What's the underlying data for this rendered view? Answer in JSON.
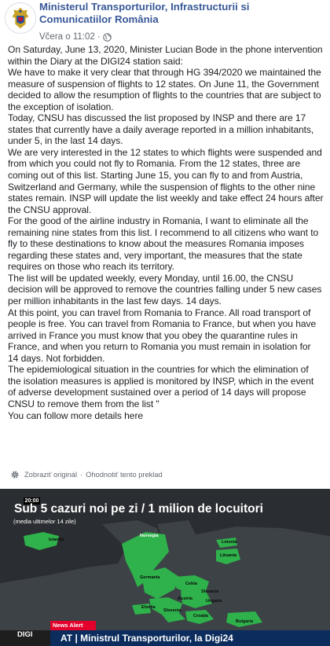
{
  "header": {
    "page_name": "Ministerul Transporturilor, Infrastructurii si Comunicatiilor România",
    "timestamp": "Včera o 11:02",
    "separator": "·",
    "privacy_icon": "globe-icon",
    "avatar_icon": "romanian-coat-of-arms"
  },
  "post": {
    "paragraphs": [
      "On Saturday, June 13, 2020, Minister Lucian Bode in the phone intervention within the Diary at the DIGI24 station said:",
      "We have to make it very clear that through HG 394/2020 we maintained the measure of suspension of flights to 12 states. On June 11, the Government decided to allow the resumption of flights to the countries that are subject to the exception of isolation.",
      "Today, CNSU has discussed the list proposed by INSP and there are 17 states that currently have a daily average reported in a million inhabitants, under 5, in the last 14 days.",
      "We are very interested in the 12 states to which flights were suspended and from which you could not fly to Romania. From the 12 states, three are coming out of this list. Starting June 15, you can fly to and from Austria, Switzerland and Germany, while the suspension of flights to the other nine states remain. INSP will update the list weekly and take effect 24 hours after the CNSU approval.",
      "For the good of the airline industry in Romania, I want to eliminate all the remaining nine states from this list. I recommend to all citizens who want to fly to these destinations to know about the measures Romania imposes regarding these states and, very important, the measures that the state requires on those who reach its territory.",
      "The list will be updated weekly, every Monday, until 16.00, the CNSU decision will be approved to remove the countries falling under 5 new cases per million inhabitants in the last few days. 14 days.",
      "At this point, you can travel from Romania to France. All road transport of people is free. You can travel from Romania to France, but when you have arrived in France you must know that you obey the quarantine rules in France, and when you return to Romania you must remain in isolation for 14 days. Not forbidden.",
      "The epidemiological situation in the countries for which the elimination of the isolation measures is applied is monitored by INSP, which in the event of adverse development sustained over a period of 14 days will propose CNSU to remove them from the list \"",
      "You can follow more details here"
    ]
  },
  "translation": {
    "icon": "gear-icon",
    "show_original": "Zobraziť originál",
    "separator": "·",
    "rate_translation": "Ohodnotiť tento preklad"
  },
  "video": {
    "time": "20:00",
    "headline": "Sub 5 cazuri noi pe zi / 1 milion de locuitori",
    "subhead": "(media ultimelor 14 zile)",
    "countries": [
      "Islanda",
      "Norvegia",
      "Letonia",
      "Lituania",
      "Germania",
      "Cehia",
      "Slovacia",
      "Austria",
      "Ungaria",
      "Elveția",
      "Slovenia",
      "Croația",
      "Bulgaria"
    ],
    "news_alert": "News Alert",
    "ticker": "AT | Ministrul Transporturilor, la Digi24",
    "channel_logo": "DIGI",
    "colors": {
      "land": "#3c4246",
      "sea": "#2a2d31",
      "green": "#2fb14b",
      "ticker_bg": "#0b2c5c",
      "alert_red": "#e4002b"
    }
  }
}
